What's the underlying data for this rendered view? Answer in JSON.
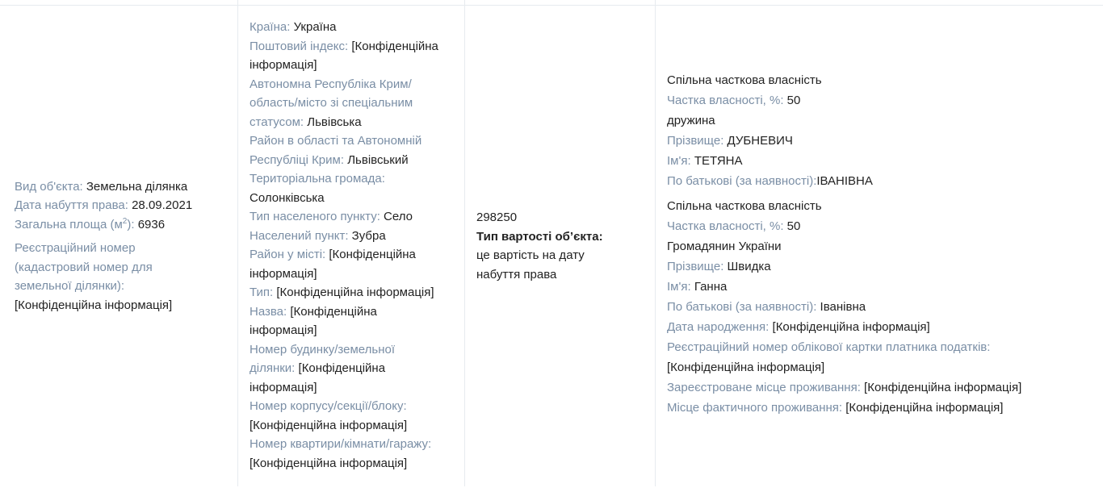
{
  "object": {
    "type_label": "Вид об'єкта:",
    "type_value": "Земельна ділянка",
    "date_label": "Дата набуття права:",
    "date_value": "28.09.2021",
    "area_label_pre": "Загальна площа (м",
    "area_label_sup": "2",
    "area_label_post": "):",
    "area_value": "6936",
    "reg_label_1": "Реєстраційний номер",
    "reg_label_2": "(кадастровий номер для",
    "reg_label_3": "земельної ділянки):",
    "reg_value": "[Конфіденційна інформація]"
  },
  "address": [
    {
      "label": "Країна:",
      "value": "Україна"
    },
    {
      "label": "Поштовий індекс:",
      "value": "[Конфіденційна",
      "cont": "інформація]"
    },
    {
      "label_1": "Автономна Республіка Крим/",
      "label_2": "область/місто зі спеціальним",
      "label_3": "статусом:",
      "value": "Львівська"
    },
    {
      "label_1": "Район в області та Автономній",
      "label_2": "Республіці Крим:",
      "value": "Львівський"
    },
    {
      "label": "Територіальна громада:",
      "value": "Солонківська"
    },
    {
      "label": "Тип населеного пункту:",
      "value": "Село"
    },
    {
      "label": "Населений пункт:",
      "value": "Зубра"
    },
    {
      "label": "Район у місті:",
      "value": "[Конфіденційна",
      "cont": "інформація]"
    },
    {
      "label": "Тип:",
      "value": "[Конфіденційна інформація]"
    },
    {
      "label": "Назва:",
      "value": "[Конфіденційна",
      "cont": "інформація]"
    },
    {
      "label_1": "Номер будинку/земельної",
      "label_2": "ділянки:",
      "value": "[Конфіденційна",
      "cont": "інформація]"
    },
    {
      "label": "Номер корпусу/секції/блоку:",
      "value": "[Конфіденційна інформація]"
    },
    {
      "label": "Номер квартири/кімнати/гаражу:",
      "value": "[Конфіденційна інформація]"
    }
  ],
  "cost": {
    "value": "298250",
    "type_label": "Тип вартості об’єкта:",
    "type_value_1": "це вартість на дату",
    "type_value_2": "набуття права"
  },
  "owners": [
    {
      "ownership": "Спільна часткова власність",
      "share_label": "Частка власності, %:",
      "share_value": "50",
      "relation": "дружина",
      "surname_label": "Прізвище:",
      "surname_value": "ДУБНЕВИЧ",
      "name_label": "Ім'я:",
      "name_value": "ТЕТЯНА",
      "patronymic_label": "По батькові (за наявності):",
      "patronymic_value": "ІВАНІВНА"
    },
    {
      "ownership": "Спільна часткова власність",
      "share_label": "Частка власності, %:",
      "share_value": "50",
      "relation": "Громадянин України",
      "surname_label": "Прізвище:",
      "surname_value": "Швидка",
      "name_label": "Ім'я:",
      "name_value": "Ганна",
      "patronymic_label": "По батькові (за наявності):",
      "patronymic_value": "Іванівна",
      "birth_label": "Дата народження:",
      "birth_value": "[Конфіденційна інформація]",
      "tax_label": "Реєстраційний номер облікової картки платника податків:",
      "tax_value": "[Конфіденційна інформація]",
      "reg_place_label": "Зареєстроване місце проживання:",
      "reg_place_value": "[Конфіденційна інформація]",
      "actual_place_label": "Місце фактичного проживання:",
      "actual_place_value": "[Конфіденційна інформація]"
    }
  ]
}
